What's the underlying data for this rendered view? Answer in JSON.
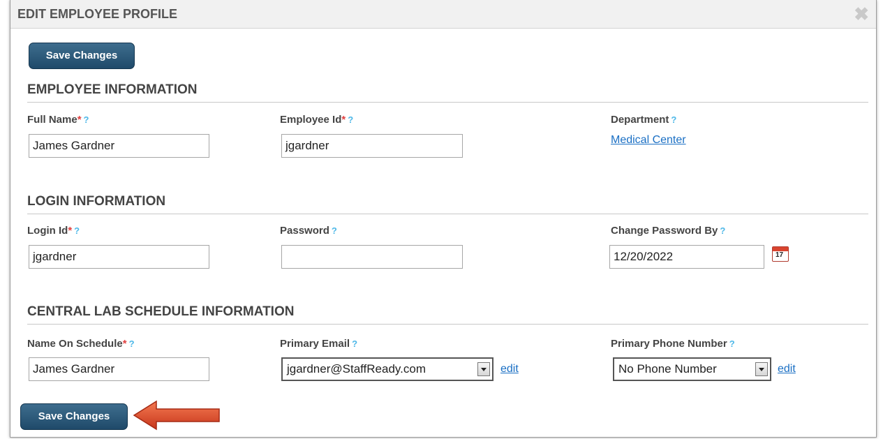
{
  "dialog": {
    "title": "EDIT EMPLOYEE PROFILE",
    "close_icon": "close-icon"
  },
  "buttons": {
    "save_top": "Save Changes",
    "save_bottom": "Save Changes"
  },
  "sections": {
    "employee": "EMPLOYEE INFORMATION",
    "login": "LOGIN INFORMATION",
    "schedule": "CENTRAL LAB SCHEDULE INFORMATION"
  },
  "help_glyph": "?",
  "required_glyph": "*",
  "employee": {
    "full_name_label": "Full Name",
    "full_name_value": "James Gardner",
    "employee_id_label": "Employee Id",
    "employee_id_value": "jgardner",
    "department_label": "Department",
    "department_value": "Medical Center"
  },
  "login": {
    "login_id_label": "Login Id",
    "login_id_value": "jgardner",
    "password_label": "Password",
    "password_value": "",
    "change_password_label": "Change Password By",
    "change_password_value": "12/20/2022",
    "calendar_day": "17"
  },
  "schedule": {
    "name_label": "Name On Schedule",
    "name_value": "James Gardner",
    "email_label": "Primary Email",
    "email_value": "jgardner@StaffReady.com",
    "email_edit": "edit",
    "phone_label": "Primary Phone Number",
    "phone_value": "No Phone Number",
    "phone_edit": "edit"
  },
  "colors": {
    "button": "#2a5678",
    "link": "#1a6fc4",
    "required": "#e04040",
    "help": "#4eb8e8",
    "arrow": "#e0492a"
  }
}
